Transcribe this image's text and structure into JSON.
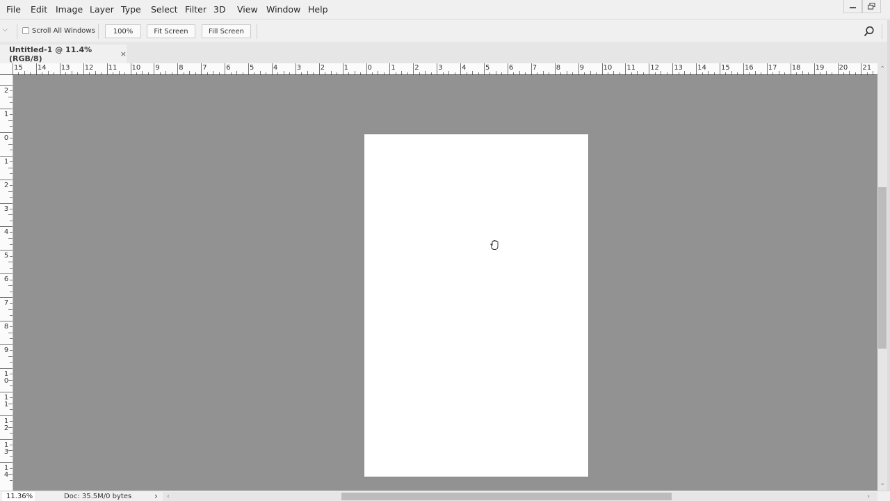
{
  "menubar": {
    "items": [
      "File",
      "Edit",
      "Image",
      "Layer",
      "Type",
      "Select",
      "Filter",
      "3D",
      "View",
      "Window",
      "Help"
    ],
    "window_controls": [
      "minimize-icon",
      "restore-icon"
    ]
  },
  "options_bar": {
    "scroll_all_windows_label": "Scroll All Windows",
    "scroll_all_windows_checked": false,
    "zoom_100_label": "100%",
    "fit_screen_label": "Fit Screen",
    "fill_screen_label": "Fill Screen",
    "search_icon": "search-icon"
  },
  "document_tab": {
    "title": "Untitled-1 @ 11.4% (RGB/8)",
    "close_glyph": "×"
  },
  "ruler_horizontal": {
    "labels": [
      "15",
      "14",
      "13",
      "12",
      "11",
      "10",
      "9",
      "8",
      "7",
      "6",
      "5",
      "4",
      "3",
      "2",
      "1",
      "0",
      "1",
      "2",
      "3",
      "4",
      "5",
      "6",
      "7",
      "8",
      "9",
      "10",
      "11",
      "12",
      "13",
      "14",
      "15",
      "16",
      "17",
      "18",
      "19",
      "20",
      "21"
    ]
  },
  "ruler_vertical": {
    "labels": [
      "2",
      "1",
      "0",
      "1",
      "2",
      "3",
      "4",
      "5",
      "6",
      "7",
      "8",
      "9",
      "10",
      "11",
      "12",
      "13",
      "14"
    ]
  },
  "canvas": {
    "background_color": "#929292",
    "document_color": "#ffffff",
    "cursor": "hand-icon"
  },
  "statusbar": {
    "zoom_value": "11.36%",
    "doc_info": "Doc: 35.5M/0 bytes",
    "expand_glyph": "›"
  }
}
